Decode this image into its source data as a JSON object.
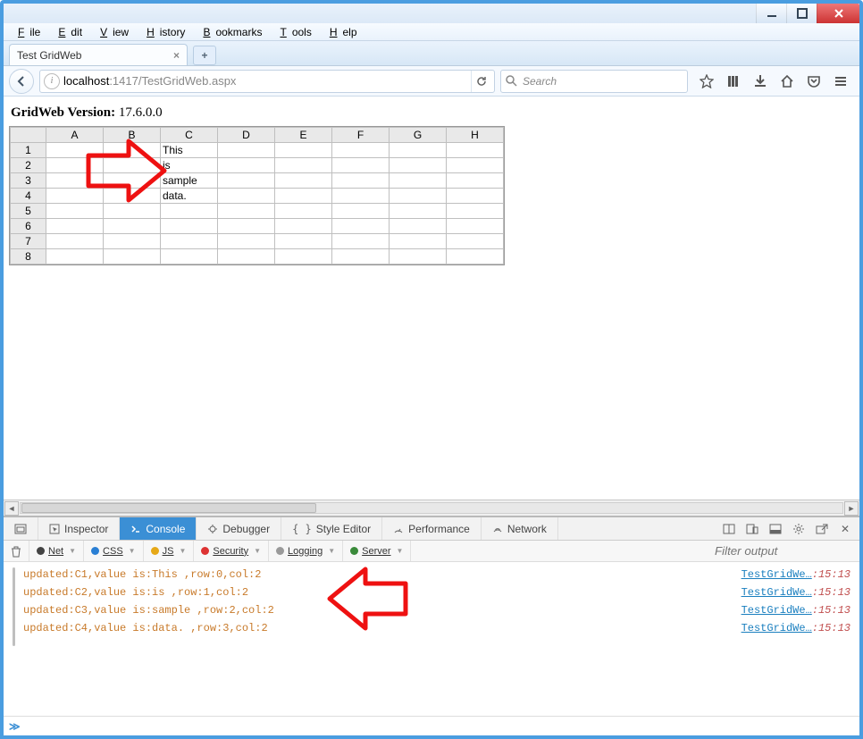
{
  "menubar": [
    "File",
    "Edit",
    "View",
    "History",
    "Bookmarks",
    "Tools",
    "Help"
  ],
  "tab": {
    "title": "Test GridWeb"
  },
  "url": {
    "host": "localhost",
    "rest": ":1417/TestGridWeb.aspx"
  },
  "search": {
    "placeholder": "Search"
  },
  "page": {
    "version_label": "GridWeb Version:",
    "version_value": "17.6.0.0",
    "columns": [
      "A",
      "B",
      "C",
      "D",
      "E",
      "F",
      "G",
      "H"
    ],
    "rows": [
      {
        "n": "1",
        "cells": {
          "C": "This"
        }
      },
      {
        "n": "2",
        "cells": {
          "C": "is"
        }
      },
      {
        "n": "3",
        "cells": {
          "C": "sample"
        }
      },
      {
        "n": "4",
        "cells": {
          "C": "data."
        }
      },
      {
        "n": "5",
        "cells": {}
      },
      {
        "n": "6",
        "cells": {}
      },
      {
        "n": "7",
        "cells": {}
      },
      {
        "n": "8",
        "cells": {}
      }
    ]
  },
  "devtools": {
    "tabs": {
      "inspector": "Inspector",
      "console": "Console",
      "debugger": "Debugger",
      "style": "Style Editor",
      "perf": "Performance",
      "network": "Network"
    },
    "filters": {
      "net": "Net",
      "css": "CSS",
      "js": "JS",
      "security": "Security",
      "logging": "Logging",
      "server": "Server"
    },
    "filter_placeholder": "Filter output",
    "source_file": "TestGridWe…",
    "source_line": ":15:13",
    "logs": [
      "updated:C1,value is:This ,row:0,col:2",
      "updated:C2,value is:is ,row:1,col:2",
      "updated:C3,value is:sample ,row:2,col:2",
      "updated:C4,value is:data. ,row:3,col:2"
    ],
    "prompt": "≫"
  }
}
